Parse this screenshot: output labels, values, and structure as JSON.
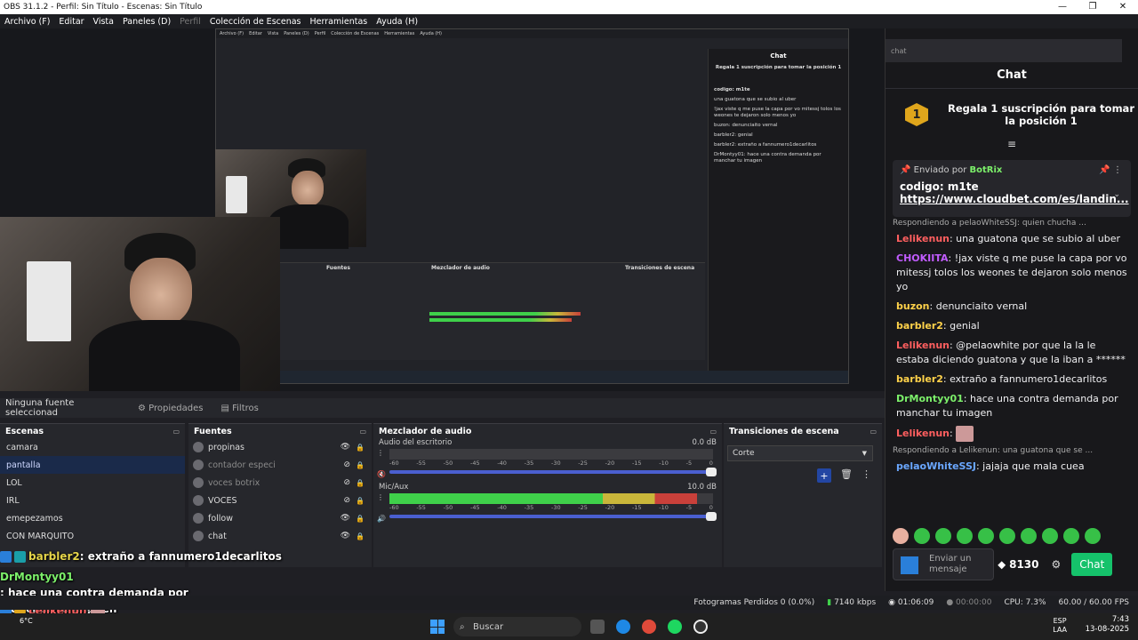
{
  "window": {
    "title": "OBS 31.1.2 - Perfil: Sin Título - Escenas: Sin Título",
    "min": "—",
    "max": "❐",
    "close": "✕"
  },
  "menu": [
    "Archivo (F)",
    "Editar",
    "Vista",
    "Paneles (D)",
    "Perfil",
    "Colección de Escenas",
    "Herramientas",
    "Ayuda (H)"
  ],
  "props_bar": {
    "no_source": "Ninguna fuente seleccionad",
    "properties": "Propiedades",
    "filters": "Filtros"
  },
  "scenes": {
    "title": "Escenas",
    "items": [
      "camara",
      "pantalla",
      "LOL",
      "IRL",
      "emepezamos",
      "CON MARQUITO"
    ],
    "selected": 1
  },
  "sources": {
    "title": "Fuentes",
    "items": [
      {
        "name": "propinas",
        "visible": true
      },
      {
        "name": "contador especi",
        "visible": false
      },
      {
        "name": "voces botrix",
        "visible": false
      },
      {
        "name": "VOCES",
        "visible": false
      },
      {
        "name": "follow",
        "visible": true
      },
      {
        "name": "chat",
        "visible": true
      }
    ]
  },
  "mixer": {
    "title": "Mezclador de audio",
    "channels": [
      {
        "name": "Audio del escritorio",
        "db": "0.0 dB",
        "level": 0
      },
      {
        "name": "Mic/Aux",
        "db": "10.0 dB",
        "level": 0.95
      }
    ],
    "ticks": [
      "-60",
      "-55",
      "-50",
      "-45",
      "-40",
      "-35",
      "-30",
      "-25",
      "-20",
      "-15",
      "-10",
      "-5",
      "0"
    ]
  },
  "transitions": {
    "title": "Transiciones de escena",
    "selected": "Corte"
  },
  "overlay_chat": [
    {
      "user": "barbler2",
      "text": ": extraño a fannumero1decarlitos"
    },
    {
      "user": "DrMontyy01",
      "text": ": hace una contra demanda por manchar tu imagen"
    },
    {
      "user": "Lelikenun",
      "text": ":"
    },
    {
      "user": "pelaoWhiteSSJ",
      "text": ": jajaja que mala cuea"
    }
  ],
  "chat": {
    "address": "chat",
    "header": "Chat",
    "goal": "Regala 1 suscripción para tomar la posición 1",
    "goal_badge": "1",
    "pinned": {
      "by": "Enviado por",
      "bot": "BotRix",
      "code": "codigo: m1te",
      "link": "https://www.cloudbet.com/es/landin..."
    },
    "reply1": "Respondiendo a pelaoWhiteSSJ: quien chucha ...",
    "messages": [
      {
        "user": "Lelikenun",
        "text": ": una guatona que se subio al uber"
      },
      {
        "user": "CHOKIITA",
        "text": ": !jax viste q me puse la capa por vo mitessj tolos los weones te dejaron solo menos yo"
      },
      {
        "user": "buzon",
        "text": ": denunciaito vernal"
      },
      {
        "user": "barbler2",
        "text": ": genial"
      },
      {
        "user": "Lelikenun",
        "text": ": @pelaowhite por que la la le estaba diciendo guatona y que la iban a ******"
      },
      {
        "user": "barbler2",
        "text": ": extraño a fannumero1decarlitos"
      },
      {
        "user": "DrMontyy01",
        "text": ": hace una contra demanda por manchar tu imagen"
      },
      {
        "user": "Lelikenun",
        "text": ":"
      }
    ],
    "reply2": "Respondiendo a Lelikenun: una guatona que se ...",
    "last": {
      "user": "pelaoWhiteSSJ",
      "text": ": jajaja que mala cuea"
    },
    "input_placeholder": "Enviar un mensaje",
    "points": "8130",
    "send": "Chat"
  },
  "status": {
    "dropped": "Fotogramas Perdidos 0 (0.0%)",
    "bitrate": "7140 kbps",
    "live": "01:06:09",
    "rec": "00:00:00",
    "cpu": "CPU: 7.3%",
    "fps": "60.00 / 60.00 FPS"
  },
  "taskbar": {
    "search": "Buscar",
    "lang1": "ESP",
    "lang2": "LAA",
    "time": "7:43",
    "date": "13-08-2025",
    "temp": "6°C"
  },
  "nested": {
    "menu": [
      "Archivo (F)",
      "Editar",
      "Vista",
      "Paneles (D)",
      "Perfil",
      "Colección de Escenas",
      "Herramientas",
      "Ayuda (H)"
    ],
    "chat_title": "Chat",
    "chat_goal": "Regala 1 suscripción para tomar la posición 1",
    "pinned": "codigo: m1te",
    "lines": [
      "una guatona que se subio al uber",
      "!jax viste q me puse la capa por vo mitessj tolos los weones te dejaron solo menos yo",
      "buzon: denunciaito vernal",
      "barbler2: genial",
      "barbler2: extraño a fannumero1decarlitos",
      "DrMontyy01: hace una contra demanda por manchar tu imagen"
    ],
    "sources_title": "Fuentes",
    "mixer_title": "Mezclador de audio",
    "trans_title": "Transiciones de escena"
  }
}
